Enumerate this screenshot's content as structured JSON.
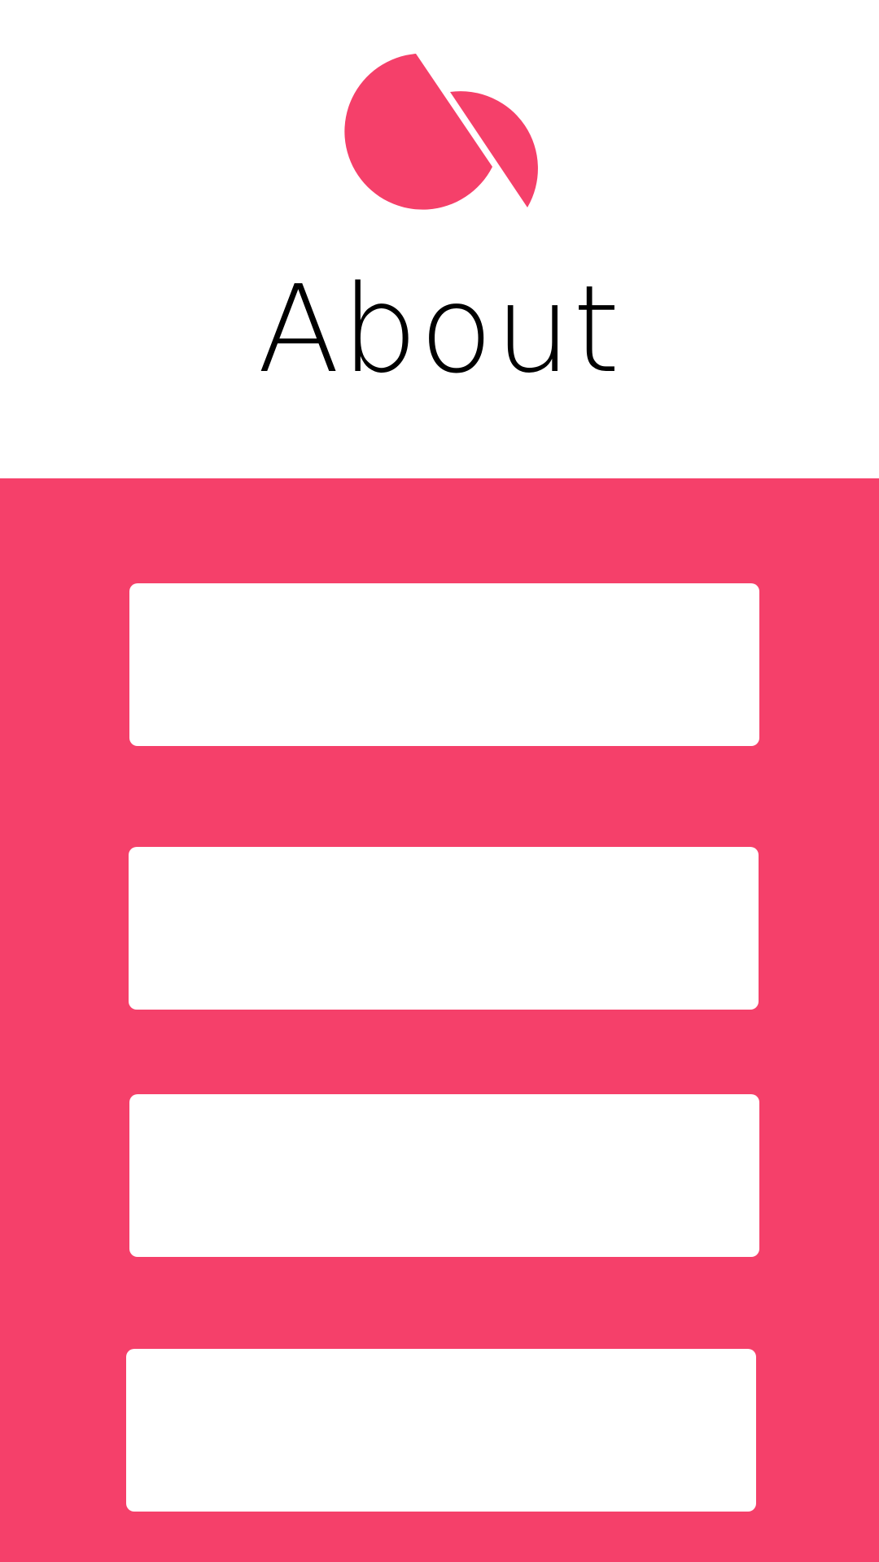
{
  "header": {
    "title": "About",
    "logo_icon": "split-circles-logo-icon"
  },
  "colors": {
    "accent": "#f5406a",
    "background": "#ffffff",
    "title_text": "#000000",
    "card": "#ffffff"
  },
  "cards": [
    {
      "label": ""
    },
    {
      "label": ""
    },
    {
      "label": ""
    },
    {
      "label": ""
    }
  ]
}
